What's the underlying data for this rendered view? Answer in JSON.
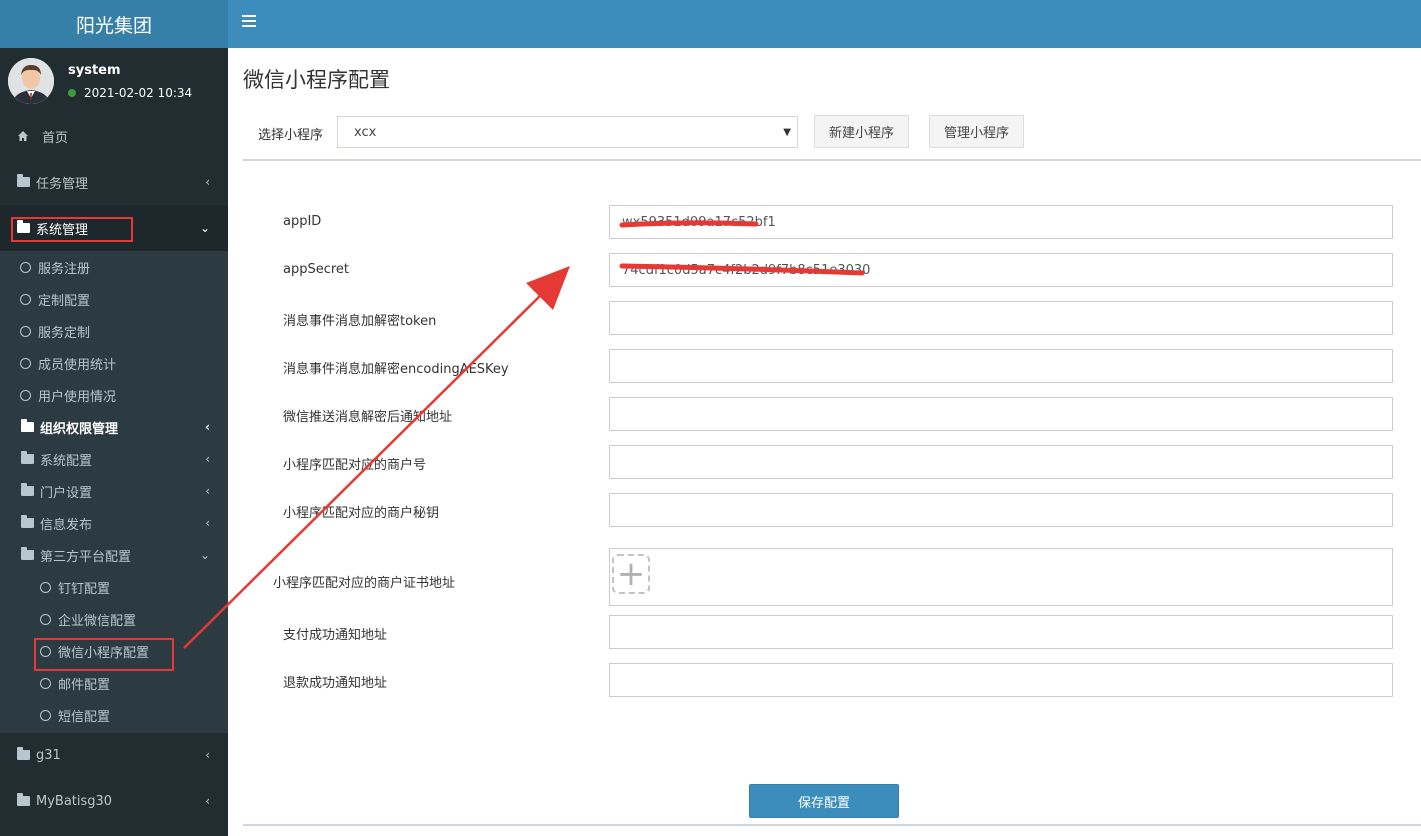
{
  "brand": {
    "title": "阳光集团"
  },
  "user": {
    "name": "system",
    "status": "2021-02-02 10:34"
  },
  "sidebar": {
    "home": "首页",
    "task_mgmt": "任务管理",
    "system_mgmt": "系统管理",
    "sub": {
      "service_register": "服务注册",
      "custom_config": "定制配置",
      "service_custom": "服务定制",
      "member_stats": "成员使用统计",
      "user_usage": "用户使用情况",
      "org_perm": "组织权限管理",
      "sys_config": "系统配置",
      "portal_settings": "门户设置",
      "info_publish": "信息发布",
      "third_party": "第三方平台配置",
      "dingtalk": "钉钉配置",
      "wecom": "企业微信配置",
      "wx_mini": "微信小程序配置",
      "mail": "邮件配置",
      "sms": "短信配置"
    },
    "g31": "g31",
    "mybatis": "MyBatisg30"
  },
  "page": {
    "title": "微信小程序配置",
    "select_label": "选择小程序",
    "select_value": "xcx",
    "new_btn": "新建小程序",
    "manage_btn": "管理小程序",
    "save_btn": "保存配置"
  },
  "form": {
    "appid_label": "appID",
    "appid_value": "wx59351d09a17c52bf1",
    "secret_label": "appSecret",
    "secret_value": "74cdf1c0d5a7c4f2b2d9f7b8c51e3030",
    "token_label": "消息事件消息加解密token",
    "aeskey_label": "消息事件消息加解密encodingAESKey",
    "notify_url_label": "微信推送消息解密后通知地址",
    "mch_id_label": "小程序匹配对应的商户号",
    "mch_key_label": "小程序匹配对应的商户秘钥",
    "cert_label": "小程序匹配对应的商户证书地址",
    "pay_notify_label": "支付成功通知地址",
    "refund_notify_label": "退款成功通知地址"
  },
  "colors": {
    "sidebar_bg": "#222d32",
    "topbar": "#3c8dbc",
    "brand_bg": "#367fa9",
    "highlight": "#e53935"
  }
}
